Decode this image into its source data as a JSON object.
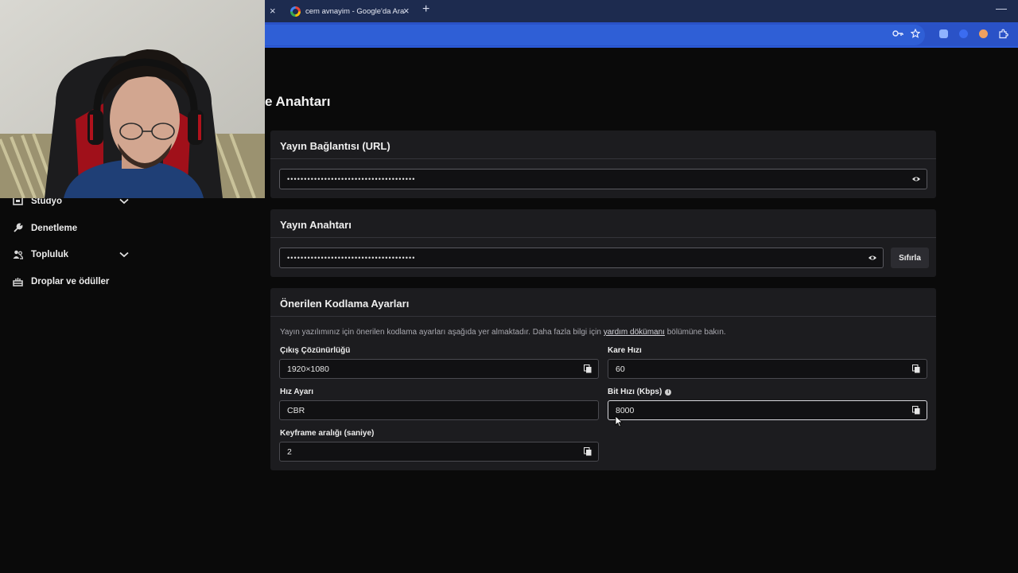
{
  "browser": {
    "tab_title": "cem avnayim - Google'da Ara",
    "new_tab_symbol": "+",
    "close_symbol": "×",
    "minimize_symbol": "—"
  },
  "page": {
    "title_partial": "e Anahtarı"
  },
  "sidebar": {
    "items": [
      {
        "label": "Stüdyo",
        "has_chevron": true,
        "icon": "film-icon"
      },
      {
        "label": "Denetleme",
        "has_chevron": false,
        "icon": "wrench-icon"
      },
      {
        "label": "Topluluk",
        "has_chevron": true,
        "icon": "users-icon"
      },
      {
        "label": "Droplar ve ödüller",
        "has_chevron": false,
        "icon": "gift-icon"
      }
    ]
  },
  "stream_url": {
    "header": "Yayın Bağlantısı (URL)",
    "masked_value": "••••••••••••••••••••••••••••••••••••••"
  },
  "stream_key": {
    "header": "Yayın Anahtarı",
    "masked_value": "••••••••••••••••••••••••••••••••••••••",
    "reset_label": "Sıfırla"
  },
  "encoding": {
    "header": "Önerilen Kodlama Ayarları",
    "description_before": "Yayın yazılımınız için önerilen kodlama ayarları aşağıda yer almaktadır. Daha fazla bilgi için",
    "description_link": "yardım dökümanı",
    "description_after": "bölümüne bakın.",
    "fields": {
      "resolution": {
        "label": "Çıkış Çözünürlüğü",
        "value": "1920×1080"
      },
      "framerate": {
        "label": "Kare Hızı",
        "value": "60"
      },
      "rate_control": {
        "label": "Hız Ayarı",
        "value": "CBR"
      },
      "bitrate": {
        "label": "Bit Hızı (Kbps)",
        "value": "8000"
      },
      "keyframe": {
        "label": "Keyframe aralığı (saniye)",
        "value": "2"
      }
    }
  },
  "colors": {
    "tabstrip": "#1d2b4f",
    "toolbar": "#2a52c7",
    "background": "#0a0a0a",
    "card": "#1c1c1f"
  }
}
